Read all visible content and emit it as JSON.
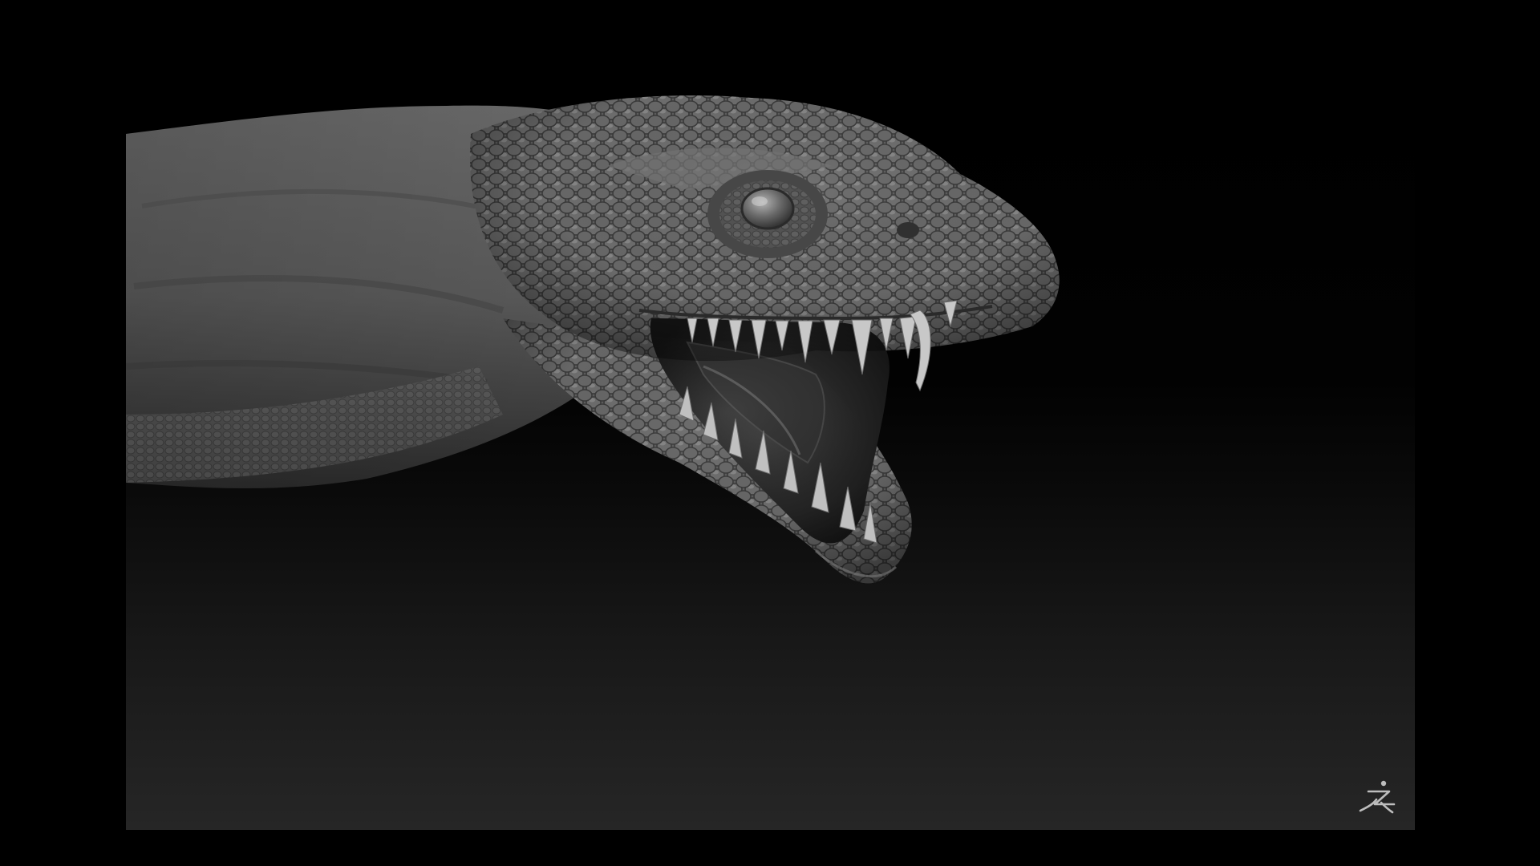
{
  "app": {
    "name": "ZBrush"
  },
  "viewport": {
    "background_top": "#000000",
    "background_bottom": "#262626",
    "letterbox_color": "#000000",
    "subject_icon": "lizard-head-sculpt-icon"
  },
  "logo": {
    "icon": "zbrush-logo-icon",
    "color": "#bdbdbd"
  }
}
